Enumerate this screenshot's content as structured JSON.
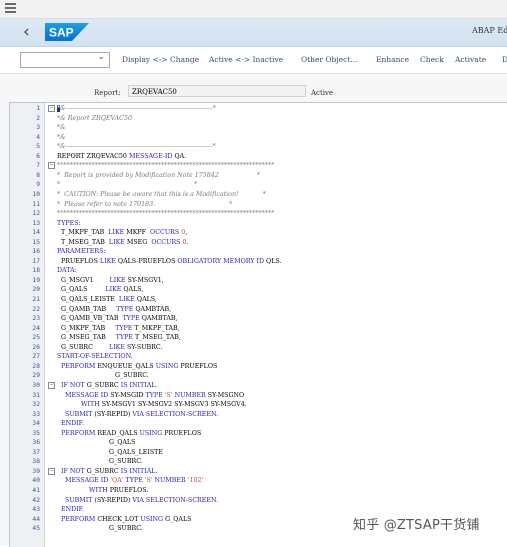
{
  "app": {
    "title": "ABAP Ed"
  },
  "logo_text": "SAP",
  "colors": {
    "keyword": "#2a23b4",
    "comment": "#7a7a7a",
    "string": "#b4502d",
    "number": "#b4502d",
    "linenum": "#3a56a8",
    "shellbar": "#d7e6f4"
  },
  "icons": [
    "menu-icon",
    "back-arrow-icon",
    "chevron-down-icon",
    "fold-icon"
  ],
  "toolbar": {
    "dropdown_value": "",
    "buttons": [
      "Display <-> Change",
      "Active <-> Inactive",
      "Other Object...",
      "Enhance",
      "Check",
      "Activate",
      "D"
    ]
  },
  "report": {
    "label": "Report:",
    "value": "ZRQEVAC50",
    "status": "Active"
  },
  "editor": {
    "lines": [
      {
        "n": "1",
        "fold": true,
        "segs": [
          [
            "*",
            "cursor"
          ],
          [
            "&---------------------------------------------------------------------*",
            "c"
          ]
        ]
      },
      {
        "n": "2",
        "segs": [
          [
            "*& Report ZRQEVAC50",
            "c"
          ]
        ]
      },
      {
        "n": "3",
        "segs": [
          [
            "*&",
            "c"
          ]
        ]
      },
      {
        "n": "4",
        "segs": [
          [
            "*&",
            "c"
          ]
        ]
      },
      {
        "n": "5",
        "segs": [
          [
            "*&---------------------------------------------------------------------*",
            "c"
          ]
        ]
      },
      {
        "n": "6",
        "segs": [
          [
            "REPORT ZRQEVAC50 ",
            "t"
          ],
          [
            "MESSAGE-ID",
            "k"
          ],
          [
            " QA.",
            "t"
          ]
        ]
      },
      {
        "n": "7",
        "fold": true,
        "segs": [
          [
            "*********************************************************************",
            "c"
          ]
        ]
      },
      {
        "n": "8",
        "segs": [
          [
            "*  Report is provided by Modification Note 175842                   *",
            "c"
          ]
        ]
      },
      {
        "n": "9",
        "segs": [
          [
            "*                                                                   *",
            "c"
          ]
        ]
      },
      {
        "n": "10",
        "segs": [
          [
            "*  CAUTION: Please be aware that this is a Modification!            *",
            "c"
          ]
        ]
      },
      {
        "n": "11",
        "segs": [
          [
            "*  Please refer to note 170183.                                     *",
            "c"
          ]
        ]
      },
      {
        "n": "12",
        "segs": [
          [
            "*********************************************************************",
            "c"
          ]
        ]
      },
      {
        "n": "13",
        "segs": [
          [
            "TYPES:",
            "k"
          ]
        ]
      },
      {
        "n": "14",
        "segs": [
          [
            "  T_MKPF_TAB  ",
            "t"
          ],
          [
            "LIKE",
            "k"
          ],
          [
            " MKPF  ",
            "t"
          ],
          [
            "OCCURS",
            "k"
          ],
          [
            " ",
            "t"
          ],
          [
            "0",
            "s"
          ],
          [
            ",",
            "t"
          ]
        ]
      },
      {
        "n": "15",
        "segs": [
          [
            "  T_MSEG_TAB  ",
            "t"
          ],
          [
            "LIKE",
            "k"
          ],
          [
            " MSEG  ",
            "t"
          ],
          [
            "OCCURS",
            "k"
          ],
          [
            " ",
            "t"
          ],
          [
            "0",
            "s"
          ],
          [
            ".",
            "t"
          ]
        ]
      },
      {
        "n": "16",
        "segs": [
          [
            "PARAMETERS:",
            "k"
          ]
        ]
      },
      {
        "n": "17",
        "segs": [
          [
            "  PRUEFLOS ",
            "t"
          ],
          [
            "LIKE",
            "k"
          ],
          [
            " QALS-PRUEFLOS ",
            "t"
          ],
          [
            "OBLIGATORY MEMORY ID",
            "k"
          ],
          [
            " QLS.",
            "t"
          ]
        ]
      },
      {
        "n": "18",
        "segs": [
          [
            "DATA:",
            "k"
          ]
        ]
      },
      {
        "n": "19",
        "segs": [
          [
            "  G_MSGV1        ",
            "t"
          ],
          [
            "LIKE",
            "k"
          ],
          [
            " SY-MSGV1,",
            "t"
          ]
        ]
      },
      {
        "n": "20",
        "segs": [
          [
            "  G_QALS         ",
            "t"
          ],
          [
            "LIKE",
            "k"
          ],
          [
            " QALS,",
            "t"
          ]
        ]
      },
      {
        "n": "21",
        "segs": [
          [
            "  G_QALS_LEISTE  ",
            "t"
          ],
          [
            "LIKE",
            "k"
          ],
          [
            " QALS,",
            "t"
          ]
        ]
      },
      {
        "n": "22",
        "segs": [
          [
            "  G_QAMB_TAB     ",
            "t"
          ],
          [
            "TYPE",
            "k"
          ],
          [
            " QAMBTAB,",
            "t"
          ]
        ]
      },
      {
        "n": "23",
        "segs": [
          [
            "  G_QAMB_VB_TAB  ",
            "t"
          ],
          [
            "TYPE",
            "k"
          ],
          [
            " QAMBTAB,",
            "t"
          ]
        ]
      },
      {
        "n": "24",
        "segs": [
          [
            "  G_MKPF_TAB     ",
            "t"
          ],
          [
            "TYPE",
            "k"
          ],
          [
            " T_MKPF_TAB,",
            "t"
          ]
        ]
      },
      {
        "n": "25",
        "segs": [
          [
            "  G_MSEG_TAB     ",
            "t"
          ],
          [
            "TYPE",
            "k"
          ],
          [
            " T_MSEG_TAB,",
            "t"
          ]
        ]
      },
      {
        "n": "26",
        "segs": [
          [
            "  G_SUBRC        ",
            "t"
          ],
          [
            "LIKE",
            "k"
          ],
          [
            " SY-SUBRC.",
            "t"
          ]
        ]
      },
      {
        "n": "27",
        "segs": [
          [
            "START-OF-SELECTION.",
            "k"
          ]
        ]
      },
      {
        "n": "28",
        "segs": [
          [
            "  ",
            "t"
          ],
          [
            "PERFORM",
            "k"
          ],
          [
            " ENQUEUE_QALS ",
            "t"
          ],
          [
            "USING",
            "k"
          ],
          [
            " PRUEFLOS",
            "t"
          ]
        ]
      },
      {
        "n": "29",
        "segs": [
          [
            "                             G_SUBRC.",
            "t"
          ]
        ]
      },
      {
        "n": "30",
        "fold": true,
        "segs": [
          [
            "  ",
            "t"
          ],
          [
            "IF NOT",
            "k"
          ],
          [
            " G_SUBRC ",
            "t"
          ],
          [
            "IS INITIAL.",
            "k"
          ]
        ]
      },
      {
        "n": "31",
        "segs": [
          [
            "    ",
            "t"
          ],
          [
            "MESSAGE ID",
            "k"
          ],
          [
            " SY-MSGID ",
            "t"
          ],
          [
            "TYPE",
            "k"
          ],
          [
            " ",
            "t"
          ],
          [
            "'S'",
            "s"
          ],
          [
            " ",
            "t"
          ],
          [
            "NUMBER",
            "k"
          ],
          [
            " SY-MSGNO",
            "t"
          ]
        ]
      },
      {
        "n": "32",
        "segs": [
          [
            "            ",
            "t"
          ],
          [
            "WITH",
            "k"
          ],
          [
            " SY-MSGV1 SY-MSGV2 SY-MSGV3 SY-MSGV4.",
            "t"
          ]
        ]
      },
      {
        "n": "33",
        "segs": [
          [
            "    ",
            "t"
          ],
          [
            "SUBMIT",
            "k"
          ],
          [
            " (SY-REPID) ",
            "t"
          ],
          [
            "VIA SELECTION-SCREEN.",
            "k"
          ]
        ]
      },
      {
        "n": "34",
        "segs": [
          [
            "  ",
            "t"
          ],
          [
            "ENDIF.",
            "k"
          ]
        ]
      },
      {
        "n": "35",
        "segs": [
          [
            "  ",
            "t"
          ],
          [
            "PERFORM",
            "k"
          ],
          [
            " READ_QALS ",
            "t"
          ],
          [
            "USING",
            "k"
          ],
          [
            " PRUEFLOS",
            "t"
          ]
        ]
      },
      {
        "n": "36",
        "segs": [
          [
            "                          G_QALS",
            "t"
          ]
        ]
      },
      {
        "n": "37",
        "segs": [
          [
            "                          G_QALS_LEISTE",
            "t"
          ]
        ]
      },
      {
        "n": "38",
        "segs": [
          [
            "                          G_SUBRC.",
            "t"
          ]
        ]
      },
      {
        "n": "39",
        "fold": true,
        "segs": [
          [
            "  ",
            "t"
          ],
          [
            "IF NOT",
            "k"
          ],
          [
            " G_SUBRC ",
            "t"
          ],
          [
            "IS INITIAL.",
            "k"
          ]
        ]
      },
      {
        "n": "40",
        "segs": [
          [
            "    ",
            "t"
          ],
          [
            "MESSAGE ID",
            "k"
          ],
          [
            " ",
            "t"
          ],
          [
            "'QA'",
            "s"
          ],
          [
            " ",
            "t"
          ],
          [
            "TYPE",
            "k"
          ],
          [
            " ",
            "t"
          ],
          [
            "'S'",
            "s"
          ],
          [
            " ",
            "t"
          ],
          [
            "NUMBER",
            "k"
          ],
          [
            " ",
            "t"
          ],
          [
            "'102'",
            "s"
          ]
        ]
      },
      {
        "n": "41",
        "segs": [
          [
            "                ",
            "t"
          ],
          [
            "WITH",
            "k"
          ],
          [
            " PRUEFLOS.",
            "t"
          ]
        ]
      },
      {
        "n": "42",
        "segs": [
          [
            "    ",
            "t"
          ],
          [
            "SUBMIT",
            "k"
          ],
          [
            " (SY-REPID) ",
            "t"
          ],
          [
            "VIA SELECTION-SCREEN.",
            "k"
          ]
        ]
      },
      {
        "n": "43",
        "segs": [
          [
            "  ",
            "t"
          ],
          [
            "ENDIF.",
            "k"
          ]
        ]
      },
      {
        "n": "44",
        "segs": [
          [
            "  ",
            "t"
          ],
          [
            "PERFORM",
            "k"
          ],
          [
            " CHECK_LOT ",
            "t"
          ],
          [
            "USING",
            "k"
          ],
          [
            " G_QALS",
            "t"
          ]
        ]
      },
      {
        "n": "45",
        "segs": [
          [
            "                          G_SUBRC.",
            "t"
          ]
        ]
      }
    ]
  },
  "watermark": "知乎 @ZTSAP干货铺"
}
